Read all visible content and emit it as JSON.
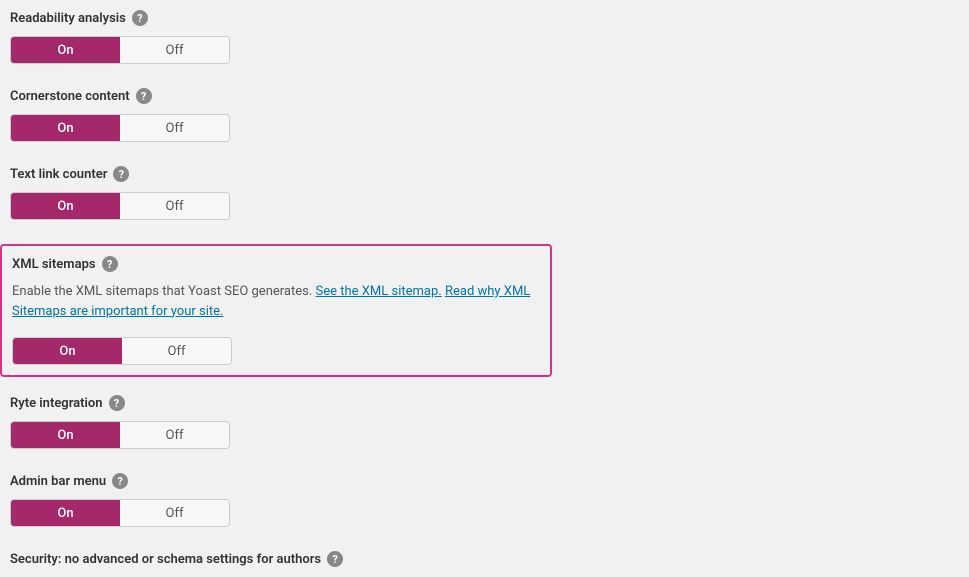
{
  "toggle": {
    "on": "On",
    "off": "Off"
  },
  "sections": {
    "readability": {
      "title": "Readability analysis"
    },
    "cornerstone": {
      "title": "Cornerstone content"
    },
    "textlink": {
      "title": "Text link counter"
    },
    "xml": {
      "title": "XML sitemaps",
      "desc_prefix": "Enable the XML sitemaps that Yoast SEO generates. ",
      "link1": "See the XML sitemap.",
      "link2": "Read why XML Sitemaps are important for your site."
    },
    "ryte": {
      "title": "Ryte integration"
    },
    "adminbar": {
      "title": "Admin bar menu"
    },
    "security": {
      "title": "Security: no advanced or schema settings for authors"
    }
  },
  "help_glyph": "?"
}
